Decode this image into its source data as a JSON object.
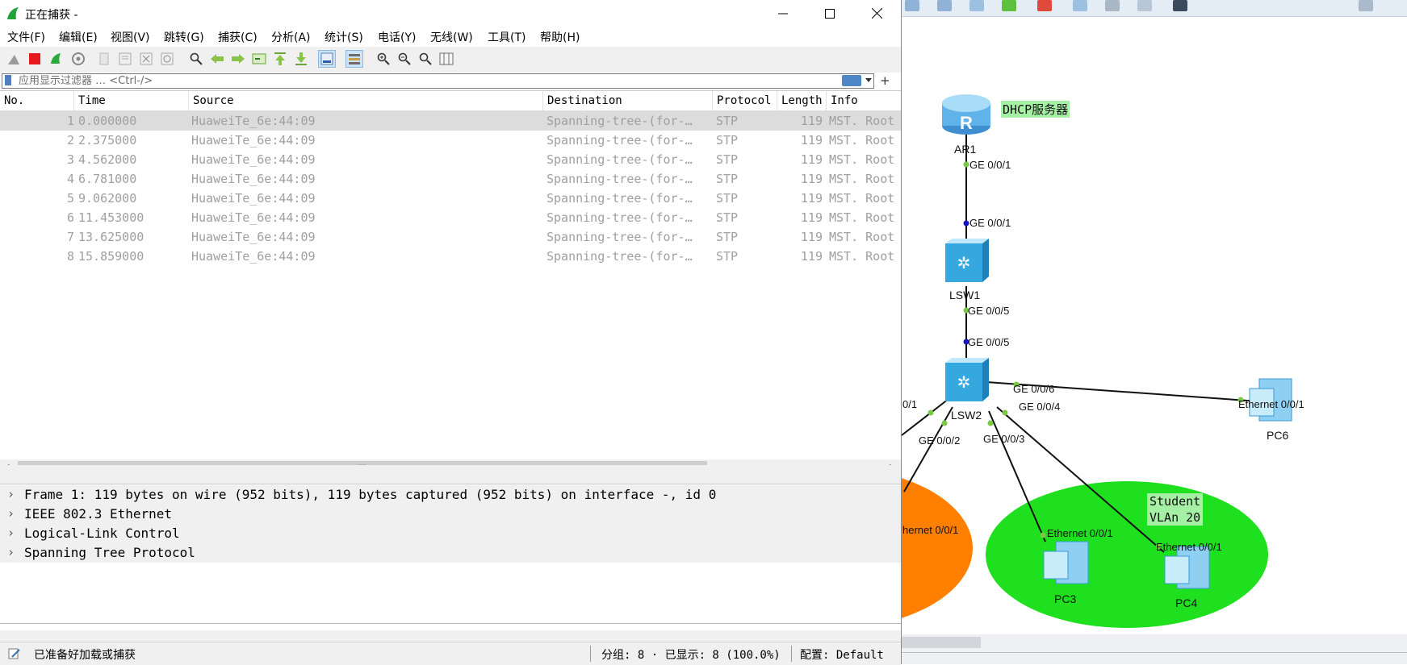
{
  "window": {
    "title": "正在捕获 -"
  },
  "menu": [
    "文件(F)",
    "编辑(E)",
    "视图(V)",
    "跳转(G)",
    "捕获(C)",
    "分析(A)",
    "统计(S)",
    "电话(Y)",
    "无线(W)",
    "工具(T)",
    "帮助(H)"
  ],
  "toolbar_icons": [
    "shark-fin-icon",
    "stop-capture-icon",
    "restart-capture-icon",
    "capture-options-icon",
    "open-file-icon",
    "save-file-icon",
    "close-file-icon",
    "reload-icon",
    "find-packet-icon",
    "go-back-icon",
    "go-forward-icon",
    "go-to-packet-icon",
    "go-first-icon",
    "go-last-icon",
    "autoscroll-icon",
    "colorize-icon",
    "zoom-in-icon",
    "zoom-out-icon",
    "zoom-normal-icon",
    "resize-columns-icon"
  ],
  "filter": {
    "placeholder": "应用显示过滤器 … <Ctrl-/>"
  },
  "packet_list": {
    "columns": [
      "No.",
      "Time",
      "Source",
      "Destination",
      "Protocol",
      "Length",
      "Info"
    ],
    "rows": [
      {
        "no": "1",
        "time": "0.000000",
        "source": "HuaweiTe_6e:44:09",
        "destination": "Spanning-tree-(for-…",
        "protocol": "STP",
        "length": "119",
        "info": "MST. Root"
      },
      {
        "no": "2",
        "time": "2.375000",
        "source": "HuaweiTe_6e:44:09",
        "destination": "Spanning-tree-(for-…",
        "protocol": "STP",
        "length": "119",
        "info": "MST. Root"
      },
      {
        "no": "3",
        "time": "4.562000",
        "source": "HuaweiTe_6e:44:09",
        "destination": "Spanning-tree-(for-…",
        "protocol": "STP",
        "length": "119",
        "info": "MST. Root"
      },
      {
        "no": "4",
        "time": "6.781000",
        "source": "HuaweiTe_6e:44:09",
        "destination": "Spanning-tree-(for-…",
        "protocol": "STP",
        "length": "119",
        "info": "MST. Root"
      },
      {
        "no": "5",
        "time": "9.062000",
        "source": "HuaweiTe_6e:44:09",
        "destination": "Spanning-tree-(for-…",
        "protocol": "STP",
        "length": "119",
        "info": "MST. Root"
      },
      {
        "no": "6",
        "time": "11.453000",
        "source": "HuaweiTe_6e:44:09",
        "destination": "Spanning-tree-(for-…",
        "protocol": "STP",
        "length": "119",
        "info": "MST. Root"
      },
      {
        "no": "7",
        "time": "13.625000",
        "source": "HuaweiTe_6e:44:09",
        "destination": "Spanning-tree-(for-…",
        "protocol": "STP",
        "length": "119",
        "info": "MST. Root"
      },
      {
        "no": "8",
        "time": "15.859000",
        "source": "HuaweiTe_6e:44:09",
        "destination": "Spanning-tree-(for-…",
        "protocol": "STP",
        "length": "119",
        "info": "MST. Root"
      }
    ]
  },
  "details": [
    "Frame 1: 119 bytes on wire (952 bits), 119 bytes captured (952 bits) on interface -, id 0",
    "IEEE 802.3 Ethernet",
    "Logical-Link Control",
    "Spanning Tree Protocol"
  ],
  "status": {
    "ready": "已准备好加载或捕获",
    "packets": "分组: 8 · 已显示: 8 (100.0%)",
    "profile": "配置: Default"
  },
  "topology": {
    "dhcp_label": "DHCP服务器",
    "devices": [
      "AR1",
      "LSW1",
      "LSW2",
      "PC3",
      "PC4",
      "PC6"
    ],
    "ports": [
      "GE 0/0/1",
      "GE 0/0/1",
      "GE 0/0/5",
      "GE 0/0/5",
      "GE 0/0/6",
      "GE 0/0/4",
      "GE 0/0/2",
      "GE 0/0/3",
      "0/1",
      "Ethernet 0/0/1",
      "Ethernet 0/0/1",
      "Ethernet 0/0/1",
      "hernet 0/0/1"
    ],
    "vlan_note": [
      "Student",
      "VLAn 20"
    ],
    "colors": {
      "orange_zone": "#ff8000",
      "green_zone": "#1fe01f",
      "label_bg": "#a6f0a6",
      "link": "#111111",
      "up_port": "#7ac943",
      "down_port": "#1414c8"
    }
  }
}
